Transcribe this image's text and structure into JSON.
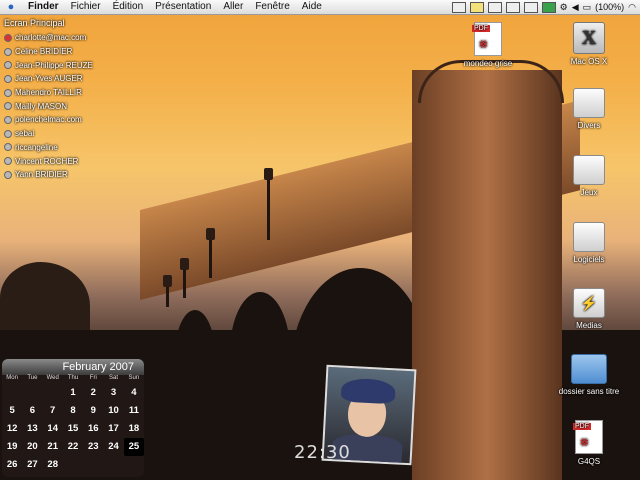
{
  "menubar": {
    "apple_icon": "apple-logo",
    "items": [
      "Finder",
      "Fichier",
      "Édition",
      "Présentation",
      "Aller",
      "Fenêtre",
      "Aide"
    ],
    "battery_text": "(100%)"
  },
  "buddy_list": {
    "header": "Ecran Principal",
    "buddies": [
      {
        "name": "charlotte@mac.com",
        "status": "red"
      },
      {
        "name": "Celine BRIDIER",
        "status": "gray"
      },
      {
        "name": "Jean-Philippe REUZE",
        "status": "gray"
      },
      {
        "name": "Jean-Yves AUGER",
        "status": "gray"
      },
      {
        "name": "Mahendro TAILLIR",
        "status": "gray"
      },
      {
        "name": "Mailly MASON",
        "status": "gray"
      },
      {
        "name": "polenchelmac.com",
        "status": "gray"
      },
      {
        "name": "sebai",
        "status": "gray"
      },
      {
        "name": "riccangeline",
        "status": "gray"
      },
      {
        "name": "Vincent ROCHER",
        "status": "gray"
      },
      {
        "name": "Yann BRIDIER",
        "status": "gray"
      }
    ]
  },
  "desktop_icons": [
    {
      "label": "mondeo grise",
      "icon": "pdf-document-icon"
    },
    {
      "label": "Mac OS X",
      "icon": "hard-disk-icon"
    },
    {
      "label": "Divers",
      "icon": "disk-icon"
    },
    {
      "label": "Jeux",
      "icon": "disk-icon"
    },
    {
      "label": "Logiciels",
      "icon": "disk-icon"
    },
    {
      "label": "Medias",
      "icon": "usb-disk-icon"
    },
    {
      "label": "dossier sans titre",
      "icon": "folder-icon"
    },
    {
      "label": "G4QS",
      "icon": "pdf-document-icon"
    }
  ],
  "calendar": {
    "month": "February 2007",
    "weekdays": [
      "Mon",
      "Tue",
      "Wed",
      "Thu",
      "Fri",
      "Sat",
      "Sun"
    ],
    "rows": [
      [
        "",
        "",
        "",
        "1",
        "2",
        "3",
        "4"
      ],
      [
        "5",
        "6",
        "7",
        "8",
        "9",
        "10",
        "11"
      ],
      [
        "12",
        "13",
        "14",
        "15",
        "16",
        "17",
        "18"
      ],
      [
        "19",
        "20",
        "21",
        "22",
        "23",
        "24",
        "25"
      ],
      [
        "26",
        "27",
        "28",
        "",
        "",
        "",
        ""
      ]
    ],
    "today": "25"
  },
  "clock": {
    "time": "22:30"
  },
  "pdf_tag": "PDF",
  "pdf_brand": "Adobe"
}
